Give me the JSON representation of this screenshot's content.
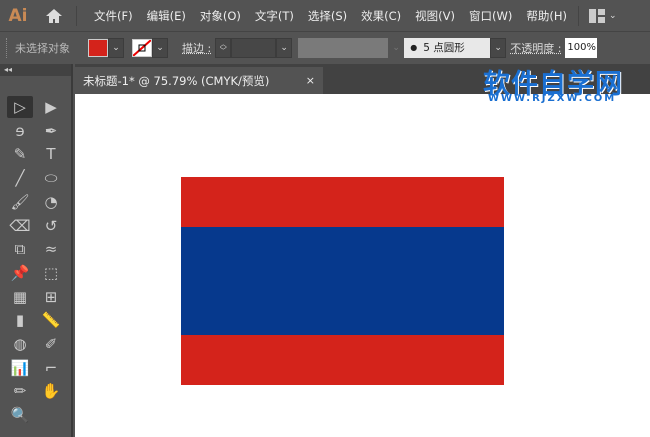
{
  "app": {
    "logo": "Ai"
  },
  "menu": [
    "文件(F)",
    "编辑(E)",
    "对象(O)",
    "文字(T)",
    "选择(S)",
    "效果(C)",
    "视图(V)",
    "窗口(W)",
    "帮助(H)"
  ],
  "control": {
    "selection": "未选择对象",
    "fill_color": "#d4231b",
    "stroke_label": "描边 :",
    "brush": "5 点圆形",
    "opacity_label": "不透明度 :",
    "opacity": "100%"
  },
  "document": {
    "tab_title": "未标题-1* @ 75.79% (CMYK/预览)",
    "close": "×"
  },
  "watermark": {
    "title": "软件自学网",
    "url": "WWW.RJZXW.COM"
  },
  "artwork": {
    "colors": {
      "red": "#d4231b",
      "blue": "#06398d"
    }
  },
  "tools": [
    "selection",
    "direct-selection",
    "lasso",
    "pen",
    "curvature",
    "type",
    "line",
    "ellipse",
    "paintbrush",
    "blob-brush",
    "eraser",
    "rotate",
    "scale",
    "warp",
    "puppet-warp",
    "free-transform",
    "perspective-grid",
    "mesh",
    "gradient",
    "measure",
    "shape-builder",
    "eyedropper",
    "graph",
    "artboard",
    "pencil",
    "hand",
    "zoom"
  ]
}
